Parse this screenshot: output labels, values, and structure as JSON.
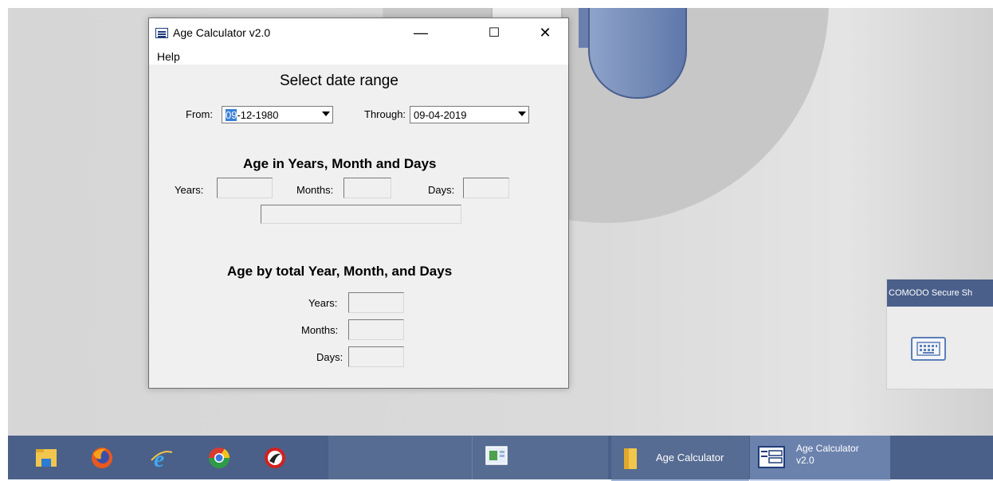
{
  "window": {
    "title": "Age Calculator v2.0",
    "minimize_glyph": "—",
    "maximize_glyph": "☐",
    "close_glyph": "✕",
    "menu": {
      "help": "Help"
    }
  },
  "date_range": {
    "heading": "Select date range",
    "from_label": "From:",
    "from_selected_part": "09",
    "from_rest": "-12-1980",
    "through_label": "Through:",
    "through_value": "09-04-2019"
  },
  "age_ymd": {
    "heading": "Age in Years, Month and Days",
    "years_label": "Years:",
    "months_label": "Months:",
    "days_label": "Days:"
  },
  "age_total": {
    "heading": "Age by total Year, Month, and Days",
    "years_label": "Years:",
    "months_label": "Months:",
    "days_label": "Days:"
  },
  "comodo": {
    "title": "COMODO Secure Sh"
  },
  "taskbar": {
    "items": [
      {
        "icon": "file-explorer-icon"
      },
      {
        "icon": "firefox-icon"
      },
      {
        "icon": "internet-explorer-icon"
      },
      {
        "icon": "chrome-icon"
      },
      {
        "icon": "comodo-dragon-icon"
      }
    ],
    "folder_label": "Age Calculator",
    "app_label_line1": "Age Calculator",
    "app_label_line2": "v2.0"
  },
  "colors": {
    "taskbar": "#4a6088",
    "selection": "#3b7fd6",
    "comodo_header": "#4a5f8a"
  }
}
